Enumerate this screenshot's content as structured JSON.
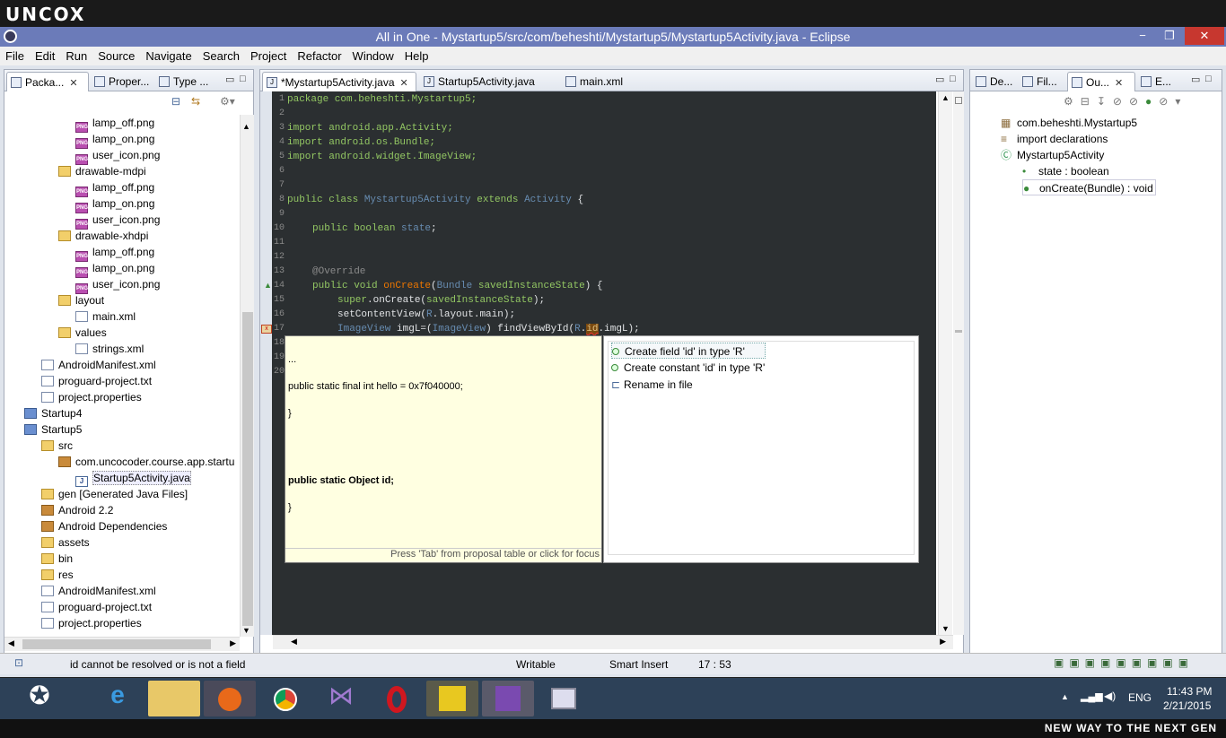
{
  "brand": {
    "logo": "UNCOX",
    "footer": "NEW WAY TO THE NEXT GEN"
  },
  "window": {
    "title": "All in One - Mystartup5/src/com/beheshti/Mystartup5/Mystartup5Activity.java - Eclipse",
    "minimize": "−",
    "maximize": "❐",
    "close": "✕"
  },
  "menu": [
    "File",
    "Edit",
    "Run",
    "Source",
    "Navigate",
    "Search",
    "Project",
    "Refactor",
    "Window",
    "Help"
  ],
  "left": {
    "tabs": [
      "Packa...",
      "Proper...",
      "Type ..."
    ],
    "tree": [
      {
        "label": "lamp_off.png",
        "icon": "png",
        "indent": 3
      },
      {
        "label": "lamp_on.png",
        "icon": "png",
        "indent": 3
      },
      {
        "label": "user_icon.png",
        "icon": "png",
        "indent": 3
      },
      {
        "label": "drawable-mdpi",
        "icon": "folder",
        "indent": 2
      },
      {
        "label": "lamp_off.png",
        "icon": "png",
        "indent": 3
      },
      {
        "label": "lamp_on.png",
        "icon": "png",
        "indent": 3
      },
      {
        "label": "user_icon.png",
        "icon": "png",
        "indent": 3
      },
      {
        "label": "drawable-xhdpi",
        "icon": "folder",
        "indent": 2
      },
      {
        "label": "lamp_off.png",
        "icon": "png",
        "indent": 3
      },
      {
        "label": "lamp_on.png",
        "icon": "png",
        "indent": 3
      },
      {
        "label": "user_icon.png",
        "icon": "png",
        "indent": 3
      },
      {
        "label": "layout",
        "icon": "folder",
        "indent": 2
      },
      {
        "label": "main.xml",
        "icon": "file",
        "indent": 3
      },
      {
        "label": "values",
        "icon": "folder",
        "indent": 2
      },
      {
        "label": "strings.xml",
        "icon": "file",
        "indent": 3
      },
      {
        "label": "AndroidManifest.xml",
        "icon": "file",
        "indent": 1
      },
      {
        "label": "proguard-project.txt",
        "icon": "file",
        "indent": 1
      },
      {
        "label": "project.properties",
        "icon": "file",
        "indent": 1
      },
      {
        "label": "Startup4",
        "icon": "proj",
        "indent": 0
      },
      {
        "label": "Startup5",
        "icon": "proj",
        "indent": 0
      },
      {
        "label": "src",
        "icon": "folder",
        "indent": 1
      },
      {
        "label": "com.uncocoder.course.app.startu",
        "icon": "pkg",
        "indent": 2
      },
      {
        "label": "Startup5Activity.java",
        "icon": "java",
        "indent": 3
      },
      {
        "label": "gen [Generated Java Files]",
        "icon": "folder",
        "indent": 1
      },
      {
        "label": "Android 2.2",
        "icon": "pkg",
        "indent": 1
      },
      {
        "label": "Android Dependencies",
        "icon": "pkg",
        "indent": 1
      },
      {
        "label": "assets",
        "icon": "folder",
        "indent": 1
      },
      {
        "label": "bin",
        "icon": "folder",
        "indent": 1
      },
      {
        "label": "res",
        "icon": "folder",
        "indent": 1
      },
      {
        "label": "AndroidManifest.xml",
        "icon": "file",
        "indent": 1
      },
      {
        "label": "proguard-project.txt",
        "icon": "file",
        "indent": 1
      },
      {
        "label": "project.properties",
        "icon": "file",
        "indent": 1
      }
    ]
  },
  "editor": {
    "tabs": [
      "*Mystartup5Activity.java",
      "Startup5Activity.java",
      "main.xml"
    ],
    "lines": [
      "1",
      "2",
      "3",
      "4",
      "5",
      "6",
      "7",
      "8",
      "9",
      "10",
      "11",
      "12",
      "13",
      "14",
      "15",
      "16",
      "17",
      "18",
      "19",
      "20"
    ],
    "code": {
      "l1": "package com.beheshti.Mystartup5;",
      "l3": "import android.app.Activity;",
      "l4": "import android.os.Bundle;",
      "l5": "import android.widget.ImageView;",
      "l8a": "public class ",
      "l8b": "Mystartup5Activity",
      "l8c": " extends ",
      "l8d": "Activity",
      "l8e": " {",
      "l10a": "public boolean ",
      "l10b": "state",
      "l10c": ";",
      "l13": "@Override",
      "l14a": "public void ",
      "l14b": "onCreate",
      "l14c": "(",
      "l14d": "Bundle",
      "l14e": " savedInstanceState",
      "l14f": ") {",
      "l15a": "super",
      "l15b": ".onCreate(",
      "l15c": "savedInstanceState",
      "l15d": ");",
      "l16a": "setContentView(",
      "l16b": "R",
      "l16c": ".layout.main);",
      "l17a": "ImageView",
      "l17b": " imgL=(",
      "l17c": "ImageView",
      "l17d": ") findViewById(",
      "l17e": "R",
      "l17f": ".",
      "l17g": "id",
      "l17h": ".imgL);"
    }
  },
  "hoverdoc": {
    "line1": "...",
    "line2": "public static final int hello = 0x7f040000;",
    "line3": "}",
    "line4": "public static Object id;",
    "line5": "}",
    "footer": "Press 'Tab' from proposal table or click for focus"
  },
  "quickfix": [
    "Create field 'id' in type 'R'",
    "Create constant 'id' in type 'R'",
    "Rename in file"
  ],
  "right": {
    "tabs": [
      "De...",
      "Fil...",
      "Ou...",
      "E..."
    ],
    "outline": [
      {
        "label": "com.beheshti.Mystartup5",
        "indent": 0
      },
      {
        "label": "import declarations",
        "indent": 0
      },
      {
        "label": "Mystartup5Activity",
        "indent": 0
      },
      {
        "label": "state : boolean",
        "indent": 1
      },
      {
        "label": "onCreate(Bundle) : void",
        "indent": 1
      }
    ]
  },
  "status": {
    "message": "id cannot be resolved or is not a field",
    "mode": "Writable",
    "insert": "Smart Insert",
    "position": "17 : 53"
  },
  "taskbar": {
    "lang": "ENG",
    "time": "11:43 PM",
    "date": "2/21/2015"
  }
}
